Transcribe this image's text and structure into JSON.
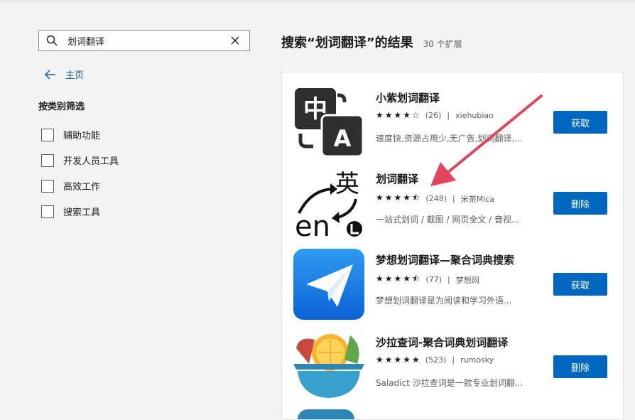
{
  "search": {
    "value": "划词翻译"
  },
  "nav": {
    "home_label": "主页"
  },
  "filters": {
    "title": "按类别筛选",
    "items": [
      "辅助功能",
      "开发人员工具",
      "高效工作",
      "搜索工具"
    ]
  },
  "results": {
    "title": "搜索“划词翻译”的结果",
    "count": "30 个扩展",
    "items": [
      {
        "name": "小紫划词翻译",
        "stars": "★★★★☆",
        "rating_value": 4,
        "rating_count": "(26)",
        "author": "xiehubiao",
        "description": "速度快,资源占用少,无广告,划词翻译,...",
        "button": "获取",
        "icon": "translate-zhong-a-icon"
      },
      {
        "name": "划词翻译",
        "stars": "★★★★⯪",
        "rating_value": 4.5,
        "rating_count": "(248)",
        "author": "米茶Mica",
        "description": "一站式划词 / 截图 / 网页全文 / 音视...",
        "button": "删除",
        "icon": "ying-en-swap-icon"
      },
      {
        "name": "梦想划词翻译—聚合词典搜索",
        "stars": "★★★★⯪",
        "rating_value": 4.5,
        "rating_count": "(77)",
        "author": "梦想网",
        "description": "梦想划词翻译是为阅读和学习外语...",
        "button": "获取",
        "icon": "paper-plane-icon"
      },
      {
        "name": "沙拉查词-聚合词典划词翻译",
        "stars": "★★★★★",
        "rating_value": 5,
        "rating_count": "(523)",
        "author": "rumosky",
        "description": "Saladict 沙拉查词是一款专业划词翻...",
        "button": "删除",
        "icon": "salad-bowl-icon"
      }
    ]
  },
  "colors": {
    "accent": "#0067c0",
    "link": "#0f5fb4",
    "annotation_arrow": "#e0465e"
  }
}
